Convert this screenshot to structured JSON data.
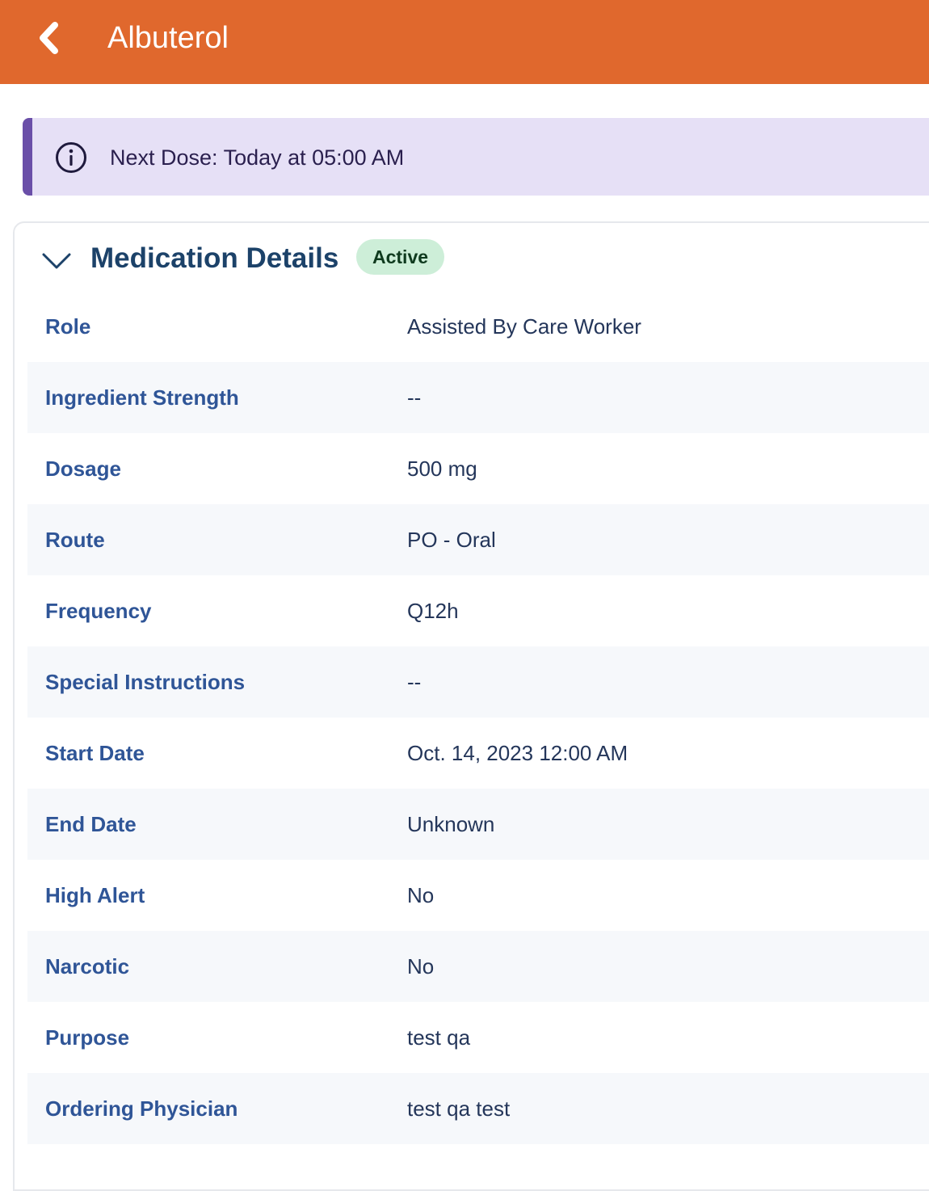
{
  "header": {
    "title": "Albuterol",
    "back_icon": "chevron-left-icon",
    "color": "#e0682d"
  },
  "banner": {
    "icon": "info-icon",
    "text": "Next Dose: Today at 05:00 AM",
    "color": "#e6e0f6",
    "accent": "#6a4fa8"
  },
  "card": {
    "title": "Medication Details",
    "toggle_icon": "chevron-down-icon",
    "status": "Active",
    "status_color": "#cdeed8",
    "rows": [
      {
        "label": "Role",
        "value": "Assisted By Care Worker"
      },
      {
        "label": "Ingredient Strength",
        "value": "--"
      },
      {
        "label": "Dosage",
        "value": "500 mg"
      },
      {
        "label": "Route",
        "value": "PO - Oral"
      },
      {
        "label": "Frequency",
        "value": "Q12h"
      },
      {
        "label": "Special Instructions",
        "value": "--"
      },
      {
        "label": "Start Date",
        "value": "Oct. 14, 2023 12:00 AM"
      },
      {
        "label": "End Date",
        "value": "Unknown"
      },
      {
        "label": "High Alert",
        "value": "No"
      },
      {
        "label": "Narcotic",
        "value": "No"
      },
      {
        "label": "Purpose",
        "value": "test qa"
      },
      {
        "label": "Ordering Physician",
        "value": "test qa test"
      }
    ]
  }
}
